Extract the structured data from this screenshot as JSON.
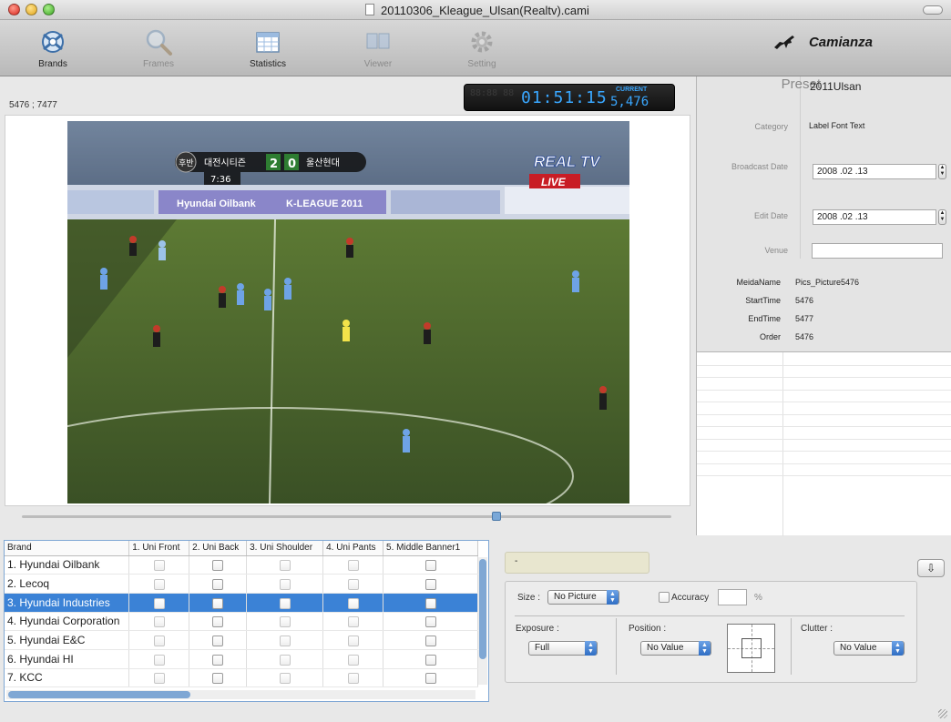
{
  "window": {
    "title": "20110306_Kleague_Ulsan(Realtv).cami"
  },
  "toolbar": {
    "items": [
      {
        "label": "Brands",
        "icon": "brands-icon",
        "enabled": true
      },
      {
        "label": "Frames",
        "icon": "magnifier-icon",
        "enabled": false
      },
      {
        "label": "Statistics",
        "icon": "spreadsheet-icon",
        "enabled": true
      },
      {
        "label": "Viewer",
        "icon": "viewer-icon",
        "enabled": false
      },
      {
        "label": "Setting",
        "icon": "gear-icon",
        "enabled": false
      }
    ],
    "brand": "Camianza"
  },
  "player": {
    "frame_counter": "5476 ; 7477",
    "timecode": "01:51:15",
    "current_label": "CURRENT",
    "current_frame": "5,476",
    "scoreboard": {
      "home": "대전시티즌",
      "score_home": "2",
      "score_away": "0",
      "away": "울산현대",
      "half": "후반",
      "time": "7:36"
    },
    "channel_logo": "REAL TV",
    "live_badge": "LIVE",
    "banner_text": "K-LEAGUE 2011",
    "banner_text_left": "Hyundai Oilbank"
  },
  "brands_table": {
    "columns": [
      "Brand",
      "1. Uni Front",
      "2. Uni Back",
      "3. Uni Shoulder",
      "4. Uni Pants",
      "5. Middle Banner1"
    ],
    "rows": [
      {
        "name": "1. Hyundai Oilbank",
        "selected": false
      },
      {
        "name": "2. Lecoq",
        "selected": false
      },
      {
        "name": "3. Hyundai Industries",
        "selected": true
      },
      {
        "name": "4. Hyundai Corporation",
        "selected": false
      },
      {
        "name": "5. Hyundai E&C",
        "selected": false
      },
      {
        "name": "6. Hyundai HI",
        "selected": false
      },
      {
        "name": "7. KCC",
        "selected": false
      }
    ]
  },
  "preset_panel": {
    "preset_label": "Preset",
    "preset_value": "2011Ulsan",
    "category_label": "Category",
    "category_value": "Label Font Text",
    "broadcast_date_label": "Broadcast Date",
    "broadcast_date_value": "2008 .02 .13",
    "edit_date_label": "Edit Date",
    "edit_date_value": "2008 .02 .13",
    "venue_label": "Venue",
    "venue_value": "",
    "media_name_label": "MeidaName",
    "media_name_value": "Pics_Picture5476",
    "start_time_label": "StartTime",
    "start_time_value": "5476",
    "end_time_label": "EndTime",
    "end_time_value": "5477",
    "order_label": "Order",
    "order_value": "5476"
  },
  "controls": {
    "note_text": "-",
    "size_label": "Size :",
    "size_value": "No Picture",
    "accuracy_label": "Accuracy",
    "accuracy_value": "",
    "accuracy_unit": "%",
    "exposure_label": "Exposure :",
    "exposure_value": "Full",
    "position_label": "Position :",
    "position_value": "No Value",
    "clutter_label": "Clutter :",
    "clutter_value": "No Value"
  },
  "colors": {
    "accent": "#3b82d6",
    "timecode": "#39a7ff",
    "live": "#c81d25"
  }
}
